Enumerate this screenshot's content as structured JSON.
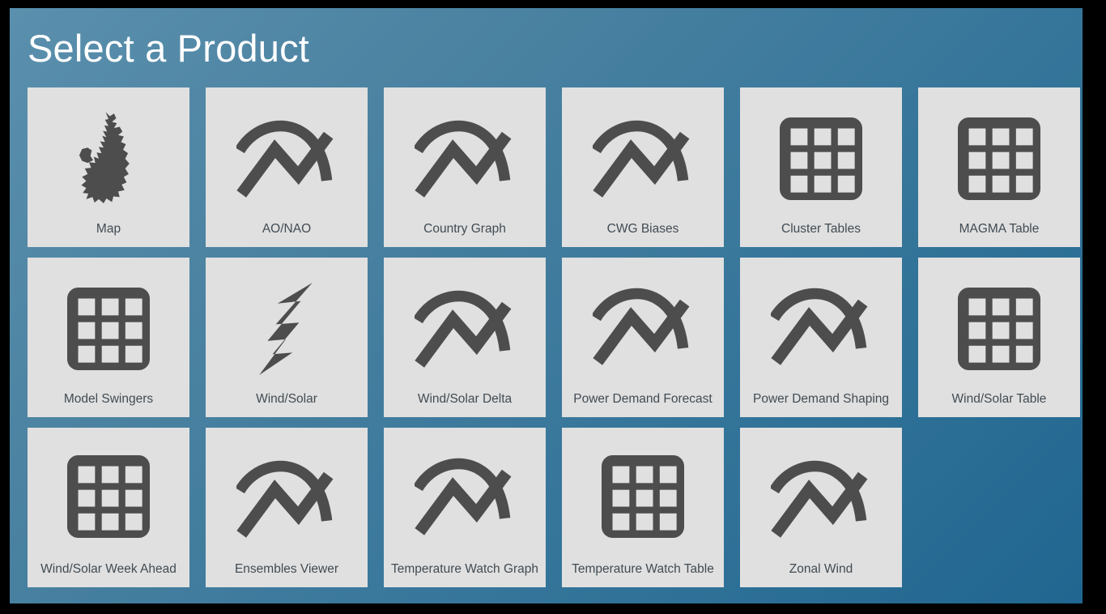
{
  "header": {
    "title": "Select a Product"
  },
  "theme": {
    "page_border": "#000000",
    "background_top_left": "#5a90ad",
    "background_bottom_right": "#206690",
    "tile_background": "#e0e0e0",
    "icon_color": "#4d4d4d",
    "label_color": "#414b53",
    "title_color": "#ffffff"
  },
  "grid": {
    "columns": 6,
    "rows": 3,
    "tiles": [
      {
        "label": "Map",
        "icon": "uk-map-icon"
      },
      {
        "label": "AO/NAO",
        "icon": "graph-icon"
      },
      {
        "label": "Country Graph",
        "icon": "graph-icon"
      },
      {
        "label": "CWG Biases",
        "icon": "graph-icon"
      },
      {
        "label": "Cluster Tables",
        "icon": "table-icon"
      },
      {
        "label": "MAGMA Table",
        "icon": "table-icon"
      },
      {
        "label": "Model Swingers",
        "icon": "table-icon"
      },
      {
        "label": "Wind/Solar",
        "icon": "lightning-bolt-icon"
      },
      {
        "label": "Wind/Solar Delta",
        "icon": "graph-icon"
      },
      {
        "label": "Power Demand Forecast",
        "icon": "graph-icon"
      },
      {
        "label": "Power Demand Shaping",
        "icon": "graph-icon"
      },
      {
        "label": "Wind/Solar Table",
        "icon": "table-icon"
      },
      {
        "label": "Wind/Solar Week Ahead",
        "icon": "table-icon"
      },
      {
        "label": "Ensembles Viewer",
        "icon": "graph-icon"
      },
      {
        "label": "Temperature Watch Graph",
        "icon": "graph-icon"
      },
      {
        "label": "Temperature Watch Table",
        "icon": "table-icon"
      },
      {
        "label": "Zonal Wind",
        "icon": "graph-icon"
      }
    ]
  }
}
